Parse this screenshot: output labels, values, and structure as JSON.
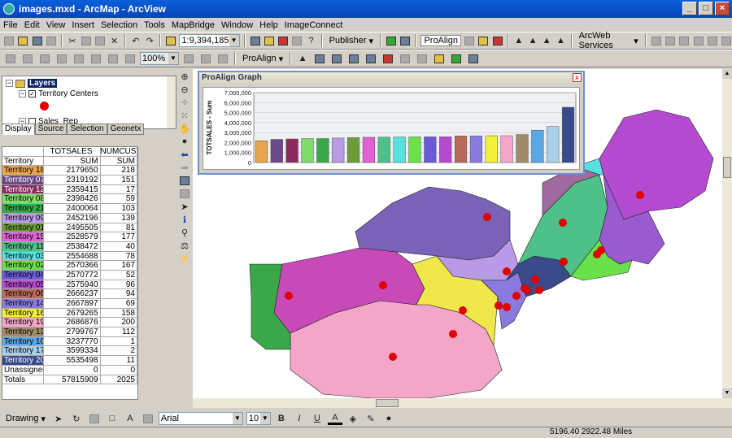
{
  "window": {
    "title": "images.mxd - ArcMap - ArcView"
  },
  "menu": [
    "File",
    "Edit",
    "View",
    "Insert",
    "Selection",
    "Tools",
    "MapBridge",
    "Window",
    "Help",
    "ImageConnect"
  ],
  "toolbar": {
    "scale_value": "1:9,394,185",
    "publisher_label": "Publisher",
    "proalign_label": "ProAlign",
    "arcweb_label": "ArcWeb Services",
    "zoom_value": "100%",
    "proalign_menu_label": "ProAlign"
  },
  "toc": {
    "layers_label": "Layers",
    "territory_layer_label": "Territory Centers",
    "sales_rep_label": "Sales_Rep",
    "tabs": [
      "Display",
      "Source",
      "Selection",
      "Geonetx"
    ]
  },
  "table": {
    "headers": [
      "",
      "TOTSALES",
      "NUMCUST"
    ],
    "subheaders": [
      "Territory",
      "SUM",
      "SUM"
    ],
    "rows": [
      {
        "name": "Territory 18",
        "totsales": "2179650",
        "numcust": "218",
        "color": "#e8a54a",
        "text": "#000"
      },
      {
        "name": "Territory 07",
        "totsales": "2319192",
        "numcust": "151",
        "color": "#6a4a86",
        "text": "#fff"
      },
      {
        "name": "Territory 12",
        "totsales": "2359415",
        "numcust": "17",
        "color": "#8a2b5e",
        "text": "#fff"
      },
      {
        "name": "Territory 08",
        "totsales": "2398426",
        "numcust": "59",
        "color": "#7fdc6a",
        "text": "#000"
      },
      {
        "name": "Territory 21",
        "totsales": "2400064",
        "numcust": "103",
        "color": "#3aa84a",
        "text": "#000"
      },
      {
        "name": "Territory 09",
        "totsales": "2452196",
        "numcust": "139",
        "color": "#b99ae6",
        "text": "#000"
      },
      {
        "name": "Territory 01",
        "totsales": "2495505",
        "numcust": "81",
        "color": "#6c9c3a",
        "text": "#000"
      },
      {
        "name": "Territory 15",
        "totsales": "2528579",
        "numcust": "177",
        "color": "#e060d6",
        "text": "#000"
      },
      {
        "name": "Territory 11",
        "totsales": "2538472",
        "numcust": "40",
        "color": "#4ec08a",
        "text": "#000"
      },
      {
        "name": "Territory 03",
        "totsales": "2554688",
        "numcust": "78",
        "color": "#5ae0e0",
        "text": "#000"
      },
      {
        "name": "Territory 02",
        "totsales": "2570366",
        "numcust": "167",
        "color": "#6ae04a",
        "text": "#000"
      },
      {
        "name": "Territory 04",
        "totsales": "2570772",
        "numcust": "52",
        "color": "#6a5ad6",
        "text": "#000"
      },
      {
        "name": "Territory 05",
        "totsales": "2575940",
        "numcust": "96",
        "color": "#b44ad0",
        "text": "#000"
      },
      {
        "name": "Territory 06",
        "totsales": "2666237",
        "numcust": "94",
        "color": "#b86a5a",
        "text": "#000"
      },
      {
        "name": "Territory 14",
        "totsales": "2667897",
        "numcust": "69",
        "color": "#8a7ae0",
        "text": "#000"
      },
      {
        "name": "Territory 16",
        "totsales": "2679265",
        "numcust": "158",
        "color": "#f4f03a",
        "text": "#000"
      },
      {
        "name": "Territory 19",
        "totsales": "2686876",
        "numcust": "200",
        "color": "#f4a6c8",
        "text": "#000"
      },
      {
        "name": "Territory 13",
        "totsales": "2799767",
        "numcust": "112",
        "color": "#a08a6a",
        "text": "#000"
      },
      {
        "name": "Territory 10",
        "totsales": "3237770",
        "numcust": "1",
        "color": "#5aa6e6",
        "text": "#000"
      },
      {
        "name": "Territory 17",
        "totsales": "3599334",
        "numcust": "2",
        "color": "#aad0e8",
        "text": "#000"
      },
      {
        "name": "Territory 20",
        "totsales": "5535498",
        "numcust": "11",
        "color": "#3a4a8a",
        "text": "#fff"
      },
      {
        "name": "Unassigned",
        "totsales": "0",
        "numcust": "0",
        "color": "#ffffff",
        "text": "#000"
      },
      {
        "name": "Totals",
        "totsales": "57815909",
        "numcust": "2025",
        "color": "#ffffff",
        "text": "#000"
      }
    ]
  },
  "graph": {
    "title": "ProAlign Graph",
    "close_label": "x"
  },
  "chart_data": {
    "type": "bar",
    "title": "",
    "ylabel": "TOTSALES - Sum",
    "xlabel": "",
    "ylim": [
      0,
      7000000
    ],
    "yticks": [
      "7,000,000",
      "6,000,000",
      "5,000,000",
      "4,000,000",
      "3,000,000",
      "2,000,000",
      "1,000,000",
      "0"
    ],
    "categories": [
      "Territory 18",
      "Territory 07",
      "Territory 12",
      "Territory 08",
      "Territory 21",
      "Territory 09",
      "Territory 01",
      "Territory 15",
      "Territory 11",
      "Territory 03",
      "Territory 02",
      "Territory 04",
      "Territory 05",
      "Territory 06",
      "Territory 14",
      "Territory 16",
      "Territory 19",
      "Territory 13",
      "Territory 10",
      "Territory 17",
      "Territory 20"
    ],
    "values": [
      2179650,
      2319192,
      2359415,
      2398426,
      2400064,
      2452196,
      2495505,
      2528579,
      2538472,
      2554688,
      2570366,
      2570772,
      2575940,
      2666237,
      2667897,
      2679265,
      2686876,
      2799767,
      3237770,
      3599334,
      5535498
    ],
    "colors": [
      "#e8a54a",
      "#6a4a86",
      "#8a2b5e",
      "#7fdc6a",
      "#3aa84a",
      "#b99ae6",
      "#6c9c3a",
      "#e060d6",
      "#4ec08a",
      "#5ae0e0",
      "#6ae04a",
      "#6a5ad6",
      "#b44ad0",
      "#b86a5a",
      "#8a7ae0",
      "#f4f03a",
      "#f4a6c8",
      "#a08a6a",
      "#5aa6e6",
      "#aad0e8",
      "#3a4a8a"
    ]
  },
  "drawing": {
    "drawing_label": "Drawing",
    "font_value": "Arial",
    "size_value": "10",
    "bold": "B",
    "italic": "I",
    "underline": "U",
    "fontcolor": "A"
  },
  "status": {
    "coords": "5196.40  2922.48 Miles"
  }
}
